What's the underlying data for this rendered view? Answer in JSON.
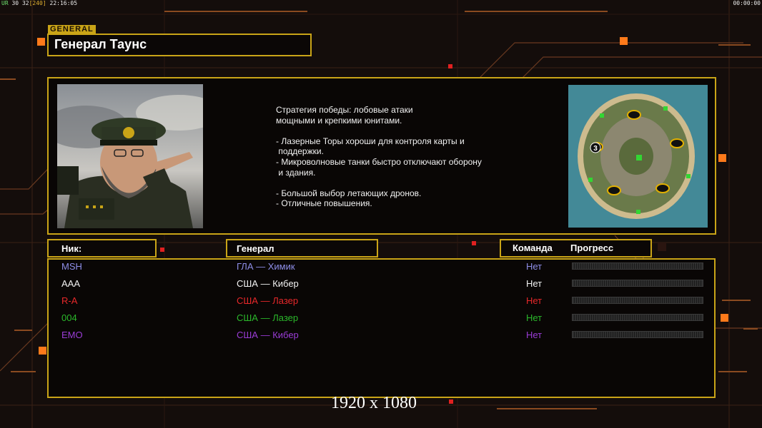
{
  "status_bar": {
    "left_prefix": "UR",
    "fps": "30",
    "frames": "32",
    "frames_bracket": "[240]",
    "clock": "22:16:05",
    "right_timer": "00:00:00"
  },
  "header": {
    "tag": "GENERAL",
    "title": "Генерал Таунс"
  },
  "description": {
    "lines": [
      "Стратегия победы: лобовые атаки\nмощными и крепкими юнитами.",
      "- Лазерные Торы хороши для контроля карты и\n поддержки.\n- Микроволновые танки быстро отключают оборону\n и здания.",
      "- Большой выбор летающих дронов.\n- Отличные повышения."
    ]
  },
  "map": {
    "player_marker": "3"
  },
  "columns": {
    "nick": "Ник:",
    "general": "Генерал",
    "team": "Команда",
    "progress": "Прогресс"
  },
  "players": [
    {
      "nick": "MSH",
      "general": "ГЛА — Химик",
      "team": "Нет",
      "color": "#8e8ee8",
      "progress": 0
    },
    {
      "nick": "AAA",
      "general": "США — Кибер",
      "team": "Нет",
      "color": "#f2f2f2",
      "progress": 0
    },
    {
      "nick": "R-A",
      "general": "США — Лазер",
      "team": "Нет",
      "color": "#e8282a",
      "progress": 0
    },
    {
      "nick": "004",
      "general": "США — Лазер",
      "team": "Нет",
      "color": "#2bb82b",
      "progress": 0
    },
    {
      "nick": "EMO",
      "general": "США — Кибер",
      "team": "Нет",
      "color": "#9a3cd6",
      "progress": 0
    }
  ],
  "resolution_label": "1920 x 1080",
  "colors": {
    "accent": "#c9a417",
    "background": "#140d0b",
    "orange_glow": "#ff7a1a"
  }
}
